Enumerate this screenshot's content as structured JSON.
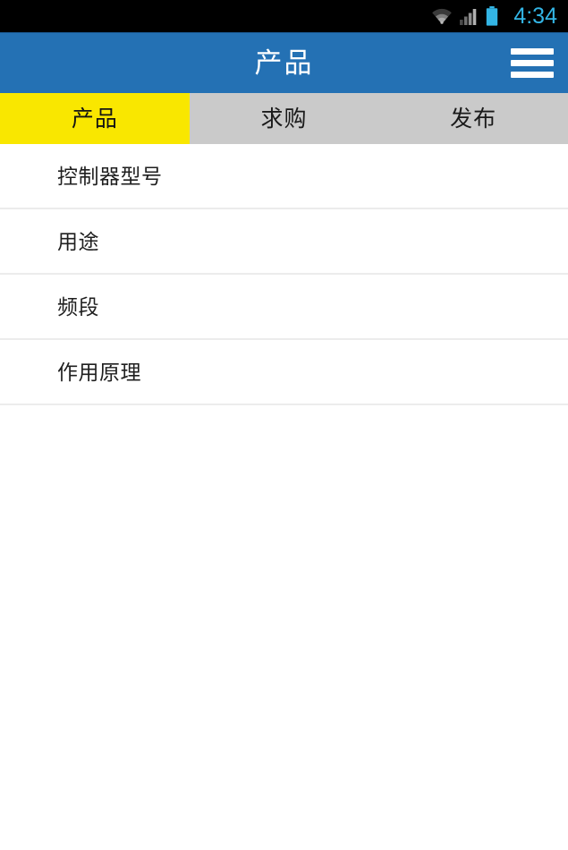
{
  "status_bar": {
    "time": "4:34",
    "time_color": "#33b5e5",
    "background": "#000000",
    "icons": [
      {
        "name": "wifi-icon",
        "color": "#8a8a8a"
      },
      {
        "name": "cellular-signal-icon",
        "color": "#8a8a8a"
      },
      {
        "name": "battery-icon",
        "color": "#33b5e5"
      }
    ]
  },
  "header": {
    "title": "产品",
    "background": "#2471b4",
    "title_color": "#ffffff",
    "menu_icon": "hamburger-menu-icon"
  },
  "tabs": {
    "active_index": 0,
    "active_background": "#f9e700",
    "inactive_background": "#cacaca",
    "items": [
      {
        "label": "产品"
      },
      {
        "label": "求购"
      },
      {
        "label": "发布"
      }
    ]
  },
  "list": {
    "items": [
      {
        "label": "控制器型号"
      },
      {
        "label": "用途"
      },
      {
        "label": "频段"
      },
      {
        "label": "作用原理"
      }
    ]
  }
}
